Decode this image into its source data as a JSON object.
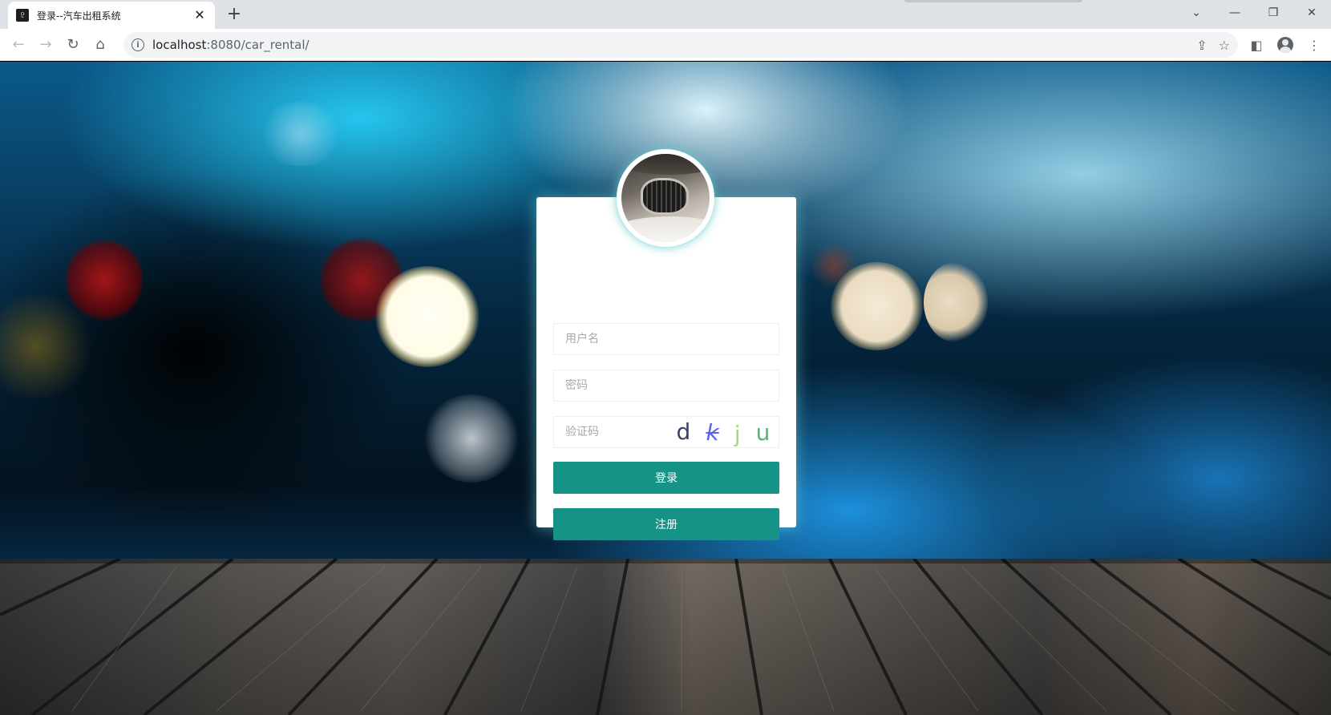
{
  "browser": {
    "tab": {
      "title": "登录--汽车出租系统",
      "favicon_glyph": "𝔏",
      "close_glyph": "✕"
    },
    "new_tab_glyph": "+",
    "window_controls": {
      "dropdown": "⌄",
      "minimize": "—",
      "restore": "❐",
      "close": "✕"
    },
    "nav": {
      "back": "←",
      "forward": "→",
      "reload": "↻",
      "home": "⌂"
    },
    "address": {
      "host": "localhost",
      "rest": ":8080/car_rental/"
    },
    "icons": {
      "info": "i",
      "share": "⇪",
      "star": "☆",
      "side_panel": "◧",
      "menu": "⋮"
    }
  },
  "login": {
    "username_placeholder": "用户名",
    "password_placeholder": "密码",
    "captcha_placeholder": "验证码",
    "captcha_chars": [
      "d",
      "k",
      "j",
      "u"
    ],
    "login_label": "登录",
    "register_label": "注册"
  },
  "colors": {
    "accent": "#159387",
    "captcha": [
      "#3d3f66",
      "#5a63ef",
      "#a3d78e",
      "#55b56a"
    ]
  }
}
